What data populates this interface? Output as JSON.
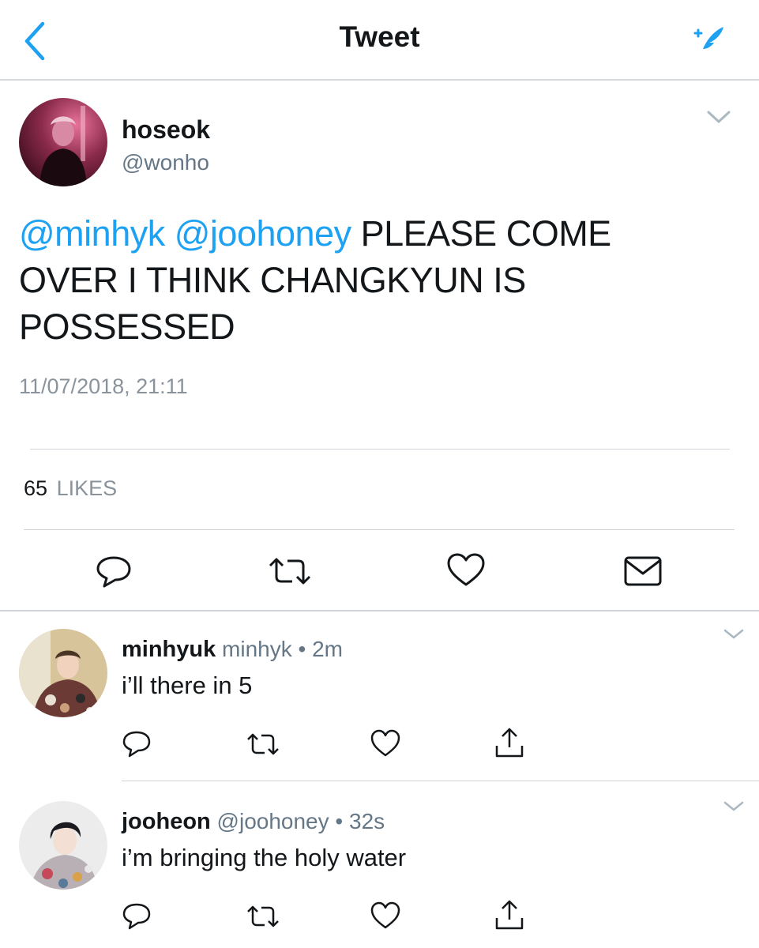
{
  "header": {
    "title": "Tweet",
    "back_icon": "chevron-left-icon",
    "compose_icon": "compose-quill-icon",
    "accent_color": "#1da1f2"
  },
  "tweet": {
    "author": {
      "name": "hoseok",
      "handle": "@wonho"
    },
    "mentions": [
      "@minhyk",
      "@joohoney"
    ],
    "text_line1": "PLEASE COME",
    "text_line2": "OVER I THINK CHANGKYUN IS",
    "text_line3": "POSSESSED",
    "timestamp": "11/07/2018, 21:11",
    "likes_count": "65",
    "likes_label": "LIKES",
    "actions": [
      "reply-icon",
      "retweet-icon",
      "like-icon",
      "direct-message-icon"
    ]
  },
  "replies": [
    {
      "name": "minhyuk",
      "handle": "minhyk",
      "separator": "•",
      "time": "2m",
      "text": "i’ll there in 5",
      "actions": [
        "reply-icon",
        "retweet-icon",
        "like-icon",
        "share-icon"
      ]
    },
    {
      "name": "jooheon",
      "handle": "@joohoney",
      "separator": "•",
      "time": "32s",
      "text": "i’m bringing the holy water",
      "actions": [
        "reply-icon",
        "retweet-icon",
        "like-icon",
        "share-icon"
      ]
    }
  ]
}
